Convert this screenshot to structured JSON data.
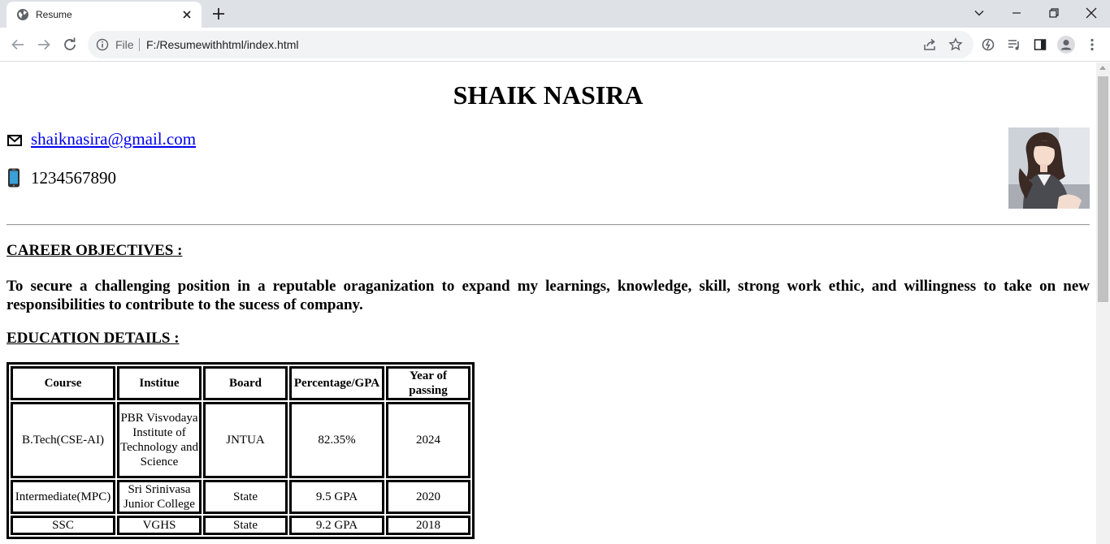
{
  "browser": {
    "tab_title": "Resume",
    "omnibox_scheme": "File",
    "url": "F:/Resumewithhtml/index.html"
  },
  "resume": {
    "name": "SHAIK NASIRA",
    "email": "shaiknasira@gmail.com",
    "phone": "1234567890",
    "career_heading": "CAREER OBJECTIVES :",
    "objective": "To secure a challenging position in a reputable oraganization to expand my learnings, knowledge, skill, strong work ethic, and willingness to take on new responsibilities to contribute to the sucess of company.",
    "education_heading": "EDUCATION DETAILS :",
    "education_table": {
      "headers": [
        "Course",
        "Institue",
        "Board",
        "Percentage/GPA",
        "Year of passing"
      ],
      "rows": [
        [
          "B.Tech(CSE-AI)",
          "PBR Visvodaya Institute of Technology and Science",
          "JNTUA",
          "82.35%",
          "2024"
        ],
        [
          "Intermediate(MPC)",
          "Sri Srinivasa Junior College",
          "State",
          "9.5 GPA",
          "2020"
        ],
        [
          "SSC",
          "VGHS",
          "State",
          "9.2 GPA",
          "2018"
        ]
      ]
    }
  },
  "colors": {
    "link": "#0000ee",
    "tabstrip": "#dee1e6",
    "omnibox": "#f1f3f4",
    "scrollbar_thumb": "#c1c1c1"
  },
  "icons": {
    "tab": "globe-icon",
    "email": "envelope-icon",
    "phone": "mobile-phone-icon"
  }
}
